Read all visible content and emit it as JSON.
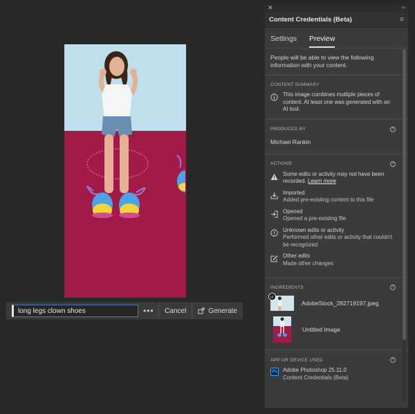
{
  "canvas": {
    "photo_alt": "Woman with long legs wearing colorful clown shoes"
  },
  "prompt_bar": {
    "input_value": "long legs clown shoes",
    "more_label": "•••",
    "cancel_label": "Cancel",
    "generate_label": "Generate"
  },
  "panel": {
    "close_glyph": "✕",
    "collapse_glyph": "‹‹",
    "title": "Content Credentials (Beta)",
    "tabs": [
      {
        "label": "Settings",
        "active": false
      },
      {
        "label": "Preview",
        "active": true
      }
    ],
    "intro": "People will be able to view the following information with your content.",
    "content_summary": {
      "heading": "CONTENT SUMMARY",
      "text": "This image combines multiple pieces of content. At least one was generated with an AI tool."
    },
    "produced_by": {
      "heading": "PRODUCED BY",
      "name": "Michael Rankin"
    },
    "actions": {
      "heading": "ACTIONS",
      "warning_text": "Some edits or activity may not have been recorded.",
      "learn_more": "Learn more",
      "items": [
        {
          "icon": "import-icon",
          "title": "Imported",
          "desc": "Added pre-existing content to this file"
        },
        {
          "icon": "open-icon",
          "title": "Opened",
          "desc": "Opened a pre-existing file"
        },
        {
          "icon": "info-icon",
          "title": "Unknown edits or activity",
          "desc": "Performed other edits or activity that couldn't be recognized"
        },
        {
          "icon": "edit-icon",
          "title": "Other edits",
          "desc": "Made other changes"
        }
      ]
    },
    "ingredients": {
      "heading": "INGREDIENTS",
      "items": [
        {
          "name": "AdobeStock_282719197.jpeg",
          "badge": "cr"
        },
        {
          "name": "Untitled Image"
        }
      ]
    },
    "app_device": {
      "heading": "APP OR DEVICE USED",
      "app_icon_label": "Ps",
      "app_name": "Adobe Photoshop 25.11.0",
      "component": "Content Credentials (Beta)"
    },
    "help_glyph": "?"
  }
}
